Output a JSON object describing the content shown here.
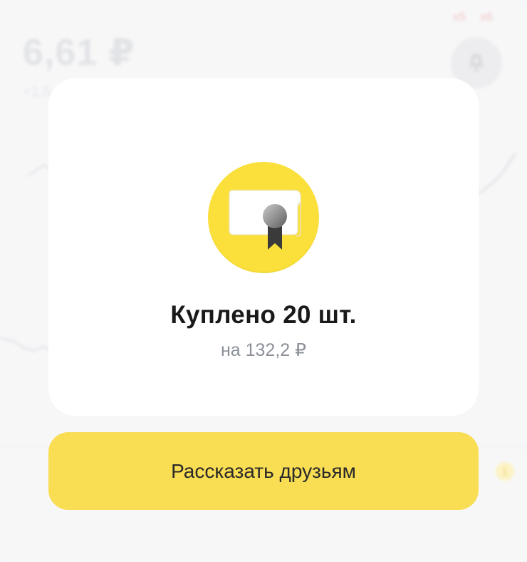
{
  "background": {
    "price": "6,61 ₽",
    "change": "+1,5",
    "tags": [
      "x5",
      "x6"
    ],
    "badge_count": "1"
  },
  "dialog": {
    "title": "Куплено 20 шт.",
    "subtitle": "на 132,2 ₽",
    "icon": "certificate-icon"
  },
  "actions": {
    "share_label": "Рассказать друзьям"
  },
  "colors": {
    "accent_yellow": "#f9dd52",
    "icon_circle": "#fbdf3a",
    "title_text": "#1a1a1a",
    "subtitle_text": "#8c9099"
  }
}
